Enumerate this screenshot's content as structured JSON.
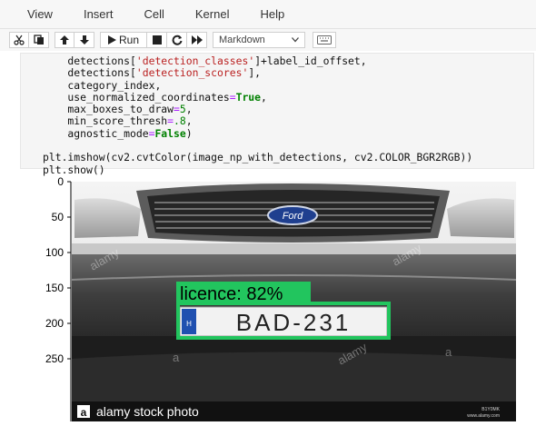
{
  "menu": {
    "items": [
      "View",
      "Insert",
      "Cell",
      "Kernel",
      "Help"
    ]
  },
  "toolbar": {
    "run_label": "Run",
    "cell_type": "Markdown",
    "icons": [
      "cut-icon",
      "copy-icon",
      "move-up-icon",
      "move-down-icon",
      "run-icon",
      "stop-icon",
      "restart-icon",
      "fast-forward-icon",
      "keyboard-icon"
    ]
  },
  "code": {
    "lines": [
      "    detections['detection_classes']+label_id_offset,",
      "    detections['detection_scores'],",
      "    category_index,",
      "    use_normalized_coordinates=True,",
      "    max_boxes_to_draw=5,",
      "    min_score_thresh=.8,",
      "    agnostic_mode=False)",
      "",
      "plt.imshow(cv2.cvtColor(image_np_with_detections, cv2.COLOR_BGR2RGB))",
      "plt.show()"
    ]
  },
  "plot": {
    "y_ticks": [
      "0",
      "50",
      "100",
      "150",
      "200",
      "250"
    ],
    "detection_label": "licence: 82%",
    "plate_text": "BAD-231",
    "plate_country": "H",
    "car_logo": "Ford",
    "watermarks": [
      "alamy",
      "alamy",
      "alamy",
      "a",
      "a",
      "a"
    ],
    "stock_bar": {
      "logo": "a",
      "text": "alamy stock photo",
      "image_id": "B1Y0MK",
      "site": "www.alamy.com"
    },
    "colors": {
      "box": "#22c55e",
      "label_bg": "#22c55e",
      "stock_bar": "#111111"
    }
  }
}
